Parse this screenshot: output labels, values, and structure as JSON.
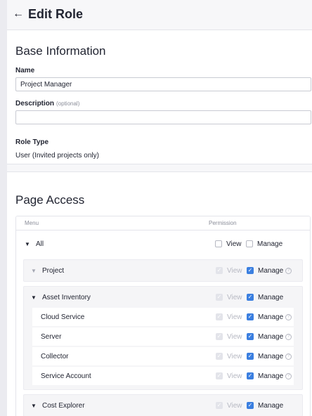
{
  "header": {
    "title": "Edit Role",
    "back_icon": "arrow-left-icon"
  },
  "base": {
    "title": "Base Information",
    "name_label": "Name",
    "name_value": "Project Manager",
    "description_label": "Description",
    "description_optional": "(optional)",
    "description_value": "",
    "role_type_label": "Role Type",
    "role_type_value": "User (Invited projects only)"
  },
  "access": {
    "title": "Page Access",
    "col_menu": "Menu",
    "col_permission": "Permission",
    "view_label": "View",
    "manage_label": "Manage",
    "all": {
      "label": "All",
      "view": false,
      "manage": false
    },
    "project": {
      "label": "Project",
      "view": true,
      "view_disabled": true,
      "manage": true
    },
    "asset_inventory": {
      "label": "Asset Inventory",
      "view": true,
      "view_disabled": true,
      "manage": true,
      "children": [
        {
          "label": "Cloud Service",
          "view": true,
          "manage": true
        },
        {
          "label": "Server",
          "view": true,
          "manage": true
        },
        {
          "label": "Collector",
          "view": true,
          "manage": true
        },
        {
          "label": "Service Account",
          "view": true,
          "manage": true
        }
      ]
    },
    "cost_explorer": {
      "label": "Cost Explorer",
      "view": true,
      "view_disabled": true,
      "manage": true
    }
  },
  "colors": {
    "accent": "#3b7fe0",
    "border": "#e3e4ea",
    "muted": "#8a8d99"
  }
}
